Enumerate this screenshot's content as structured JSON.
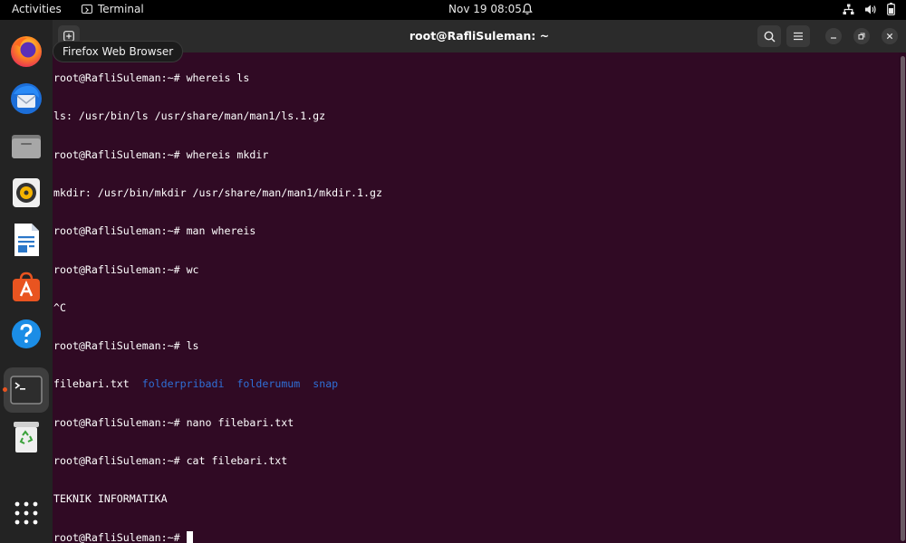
{
  "topbar": {
    "activities": "Activities",
    "app_name": "Terminal",
    "clock": "Nov 19  08:05"
  },
  "dock": {
    "tooltip": "Firefox Web Browser",
    "items": [
      "firefox",
      "thunderbird",
      "files",
      "rhythmbox",
      "libreoffice-writer",
      "app-center",
      "help",
      "terminal",
      "trash",
      "show-apps"
    ]
  },
  "window": {
    "title": "root@RafliSuleman: ~"
  },
  "terminal": {
    "lines": [
      "root@RafliSuleman:~# whereis ls",
      "ls: /usr/bin/ls /usr/share/man/man1/ls.1.gz",
      "root@RafliSuleman:~# whereis mkdir",
      "mkdir: /usr/bin/mkdir /usr/share/man/man1/mkdir.1.gz",
      "root@RafliSuleman:~# man whereis",
      "root@RafliSuleman:~# wc",
      "^C",
      "root@RafliSuleman:~# ls"
    ],
    "ls_output": {
      "file": "filebari.txt",
      "dirs": [
        "folderpribadi",
        "folderumum",
        "snap"
      ]
    },
    "lines_after": [
      "root@RafliSuleman:~# nano filebari.txt",
      "root@RafliSuleman:~# cat filebari.txt",
      "TEKNIK INFORMATIKA"
    ],
    "prompt": "root@RafliSuleman:~# "
  },
  "colors": {
    "terminal_bg": "#300a24",
    "directory": "#2f6fd6",
    "accent": "#e95420"
  }
}
